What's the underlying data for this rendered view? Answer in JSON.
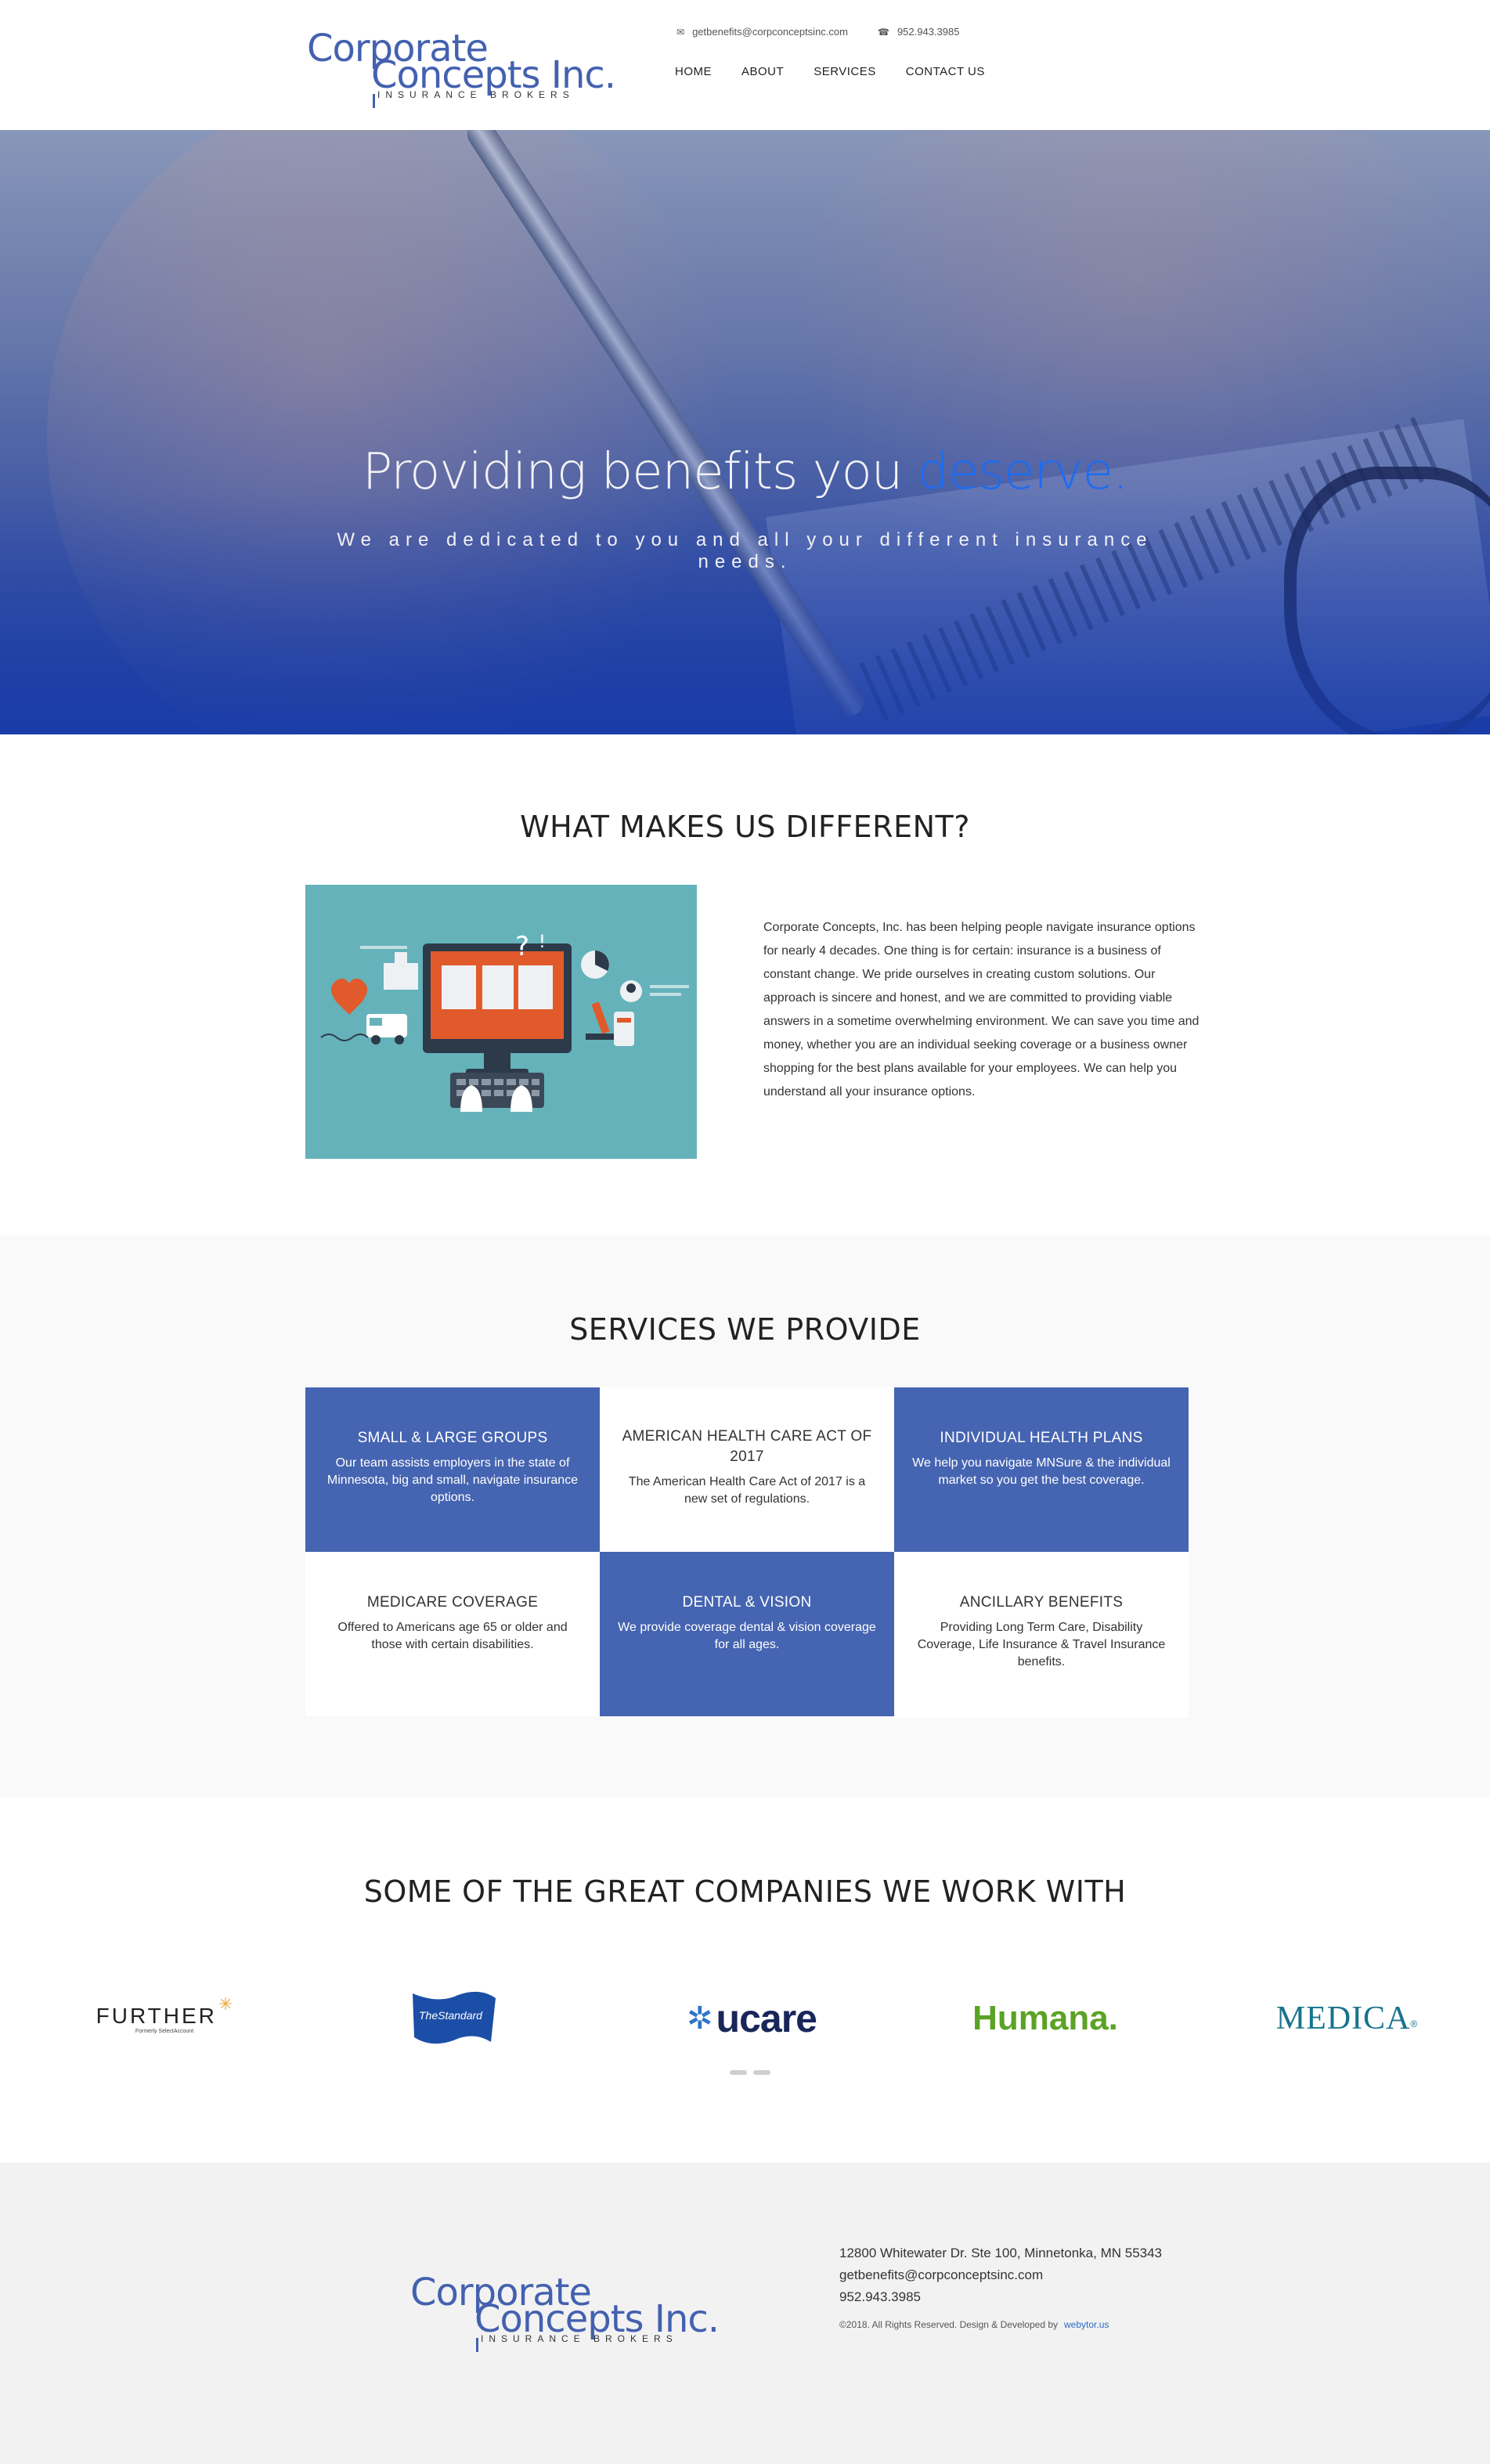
{
  "header": {
    "logo_line1": "Corporate",
    "logo_line2": "Concepts Inc.",
    "logo_sub": "INSURANCE BROKERS",
    "email": "getbenefits@corpconceptsinc.com",
    "phone": "952.943.3985",
    "nav": [
      "HOME",
      "ABOUT",
      "SERVICES",
      "CONTACT US"
    ]
  },
  "hero": {
    "title_main": "Providing benefits you ",
    "title_accent": "deserve.",
    "subtitle": "We are dedicated to you and all your different insurance needs."
  },
  "different": {
    "title": "WHAT MAKES US DIFFERENT?",
    "text": "Corporate Concepts, Inc. has been helping people navigate insurance options for nearly 4 decades. One thing is for certain: insurance is a business of constant change. We pride ourselves in creating custom solutions. Our approach is sincere and honest, and we are committed to providing viable answers in a sometime overwhelming environment. We can save you time and money, whether you are an individual seeking coverage or a business owner shopping for the best plans available for your employees. We can help you understand all your insurance options."
  },
  "services": {
    "title": "SERVICES WE PROVIDE",
    "items": [
      {
        "title": "SMALL & LARGE GROUPS",
        "text": "Our team assists employers in the state of Minnesota, big and small, navigate insurance options."
      },
      {
        "title": "AMERICAN HEALTH CARE ACT OF 2017",
        "text": "The American Health Care Act of 2017 is a new set of regulations."
      },
      {
        "title": "INDIVIDUAL HEALTH PLANS",
        "text": "We help you navigate MNSure & the individual market so you get the best coverage."
      },
      {
        "title": "MEDICARE COVERAGE",
        "text": "Offered to Americans age 65 or older and those with certain disabilities."
      },
      {
        "title": "DENTAL & VISION",
        "text": "We provide coverage dental & vision coverage for all ages."
      },
      {
        "title": "ANCILLARY BENEFITS",
        "text": "Providing Long Term Care, Disability Coverage, Life Insurance & Travel Insurance benefits."
      }
    ]
  },
  "companies": {
    "title": "SOME OF THE GREAT COMPANIES WE WORK WITH",
    "logos": {
      "further": "FURTHER",
      "further_sub": "Formerly SelectAccount",
      "standard": "TheStandard",
      "ucare": "ucare",
      "humana": "Humana.",
      "medica": "MEDICA"
    }
  },
  "footer": {
    "address": "12800 Whitewater Dr. Ste 100, Minnetonka, MN 55343",
    "email": "getbenefits@corpconceptsinc.com",
    "phone": "952.943.3985",
    "copyright": "©2018. All Rights Reserved. Design & Developed by",
    "dev_link": "webytor.us"
  },
  "colors": {
    "brand_blue": "#4461b0",
    "accent_blue": "#1b6cf2",
    "service_blue": "#4564b1"
  }
}
